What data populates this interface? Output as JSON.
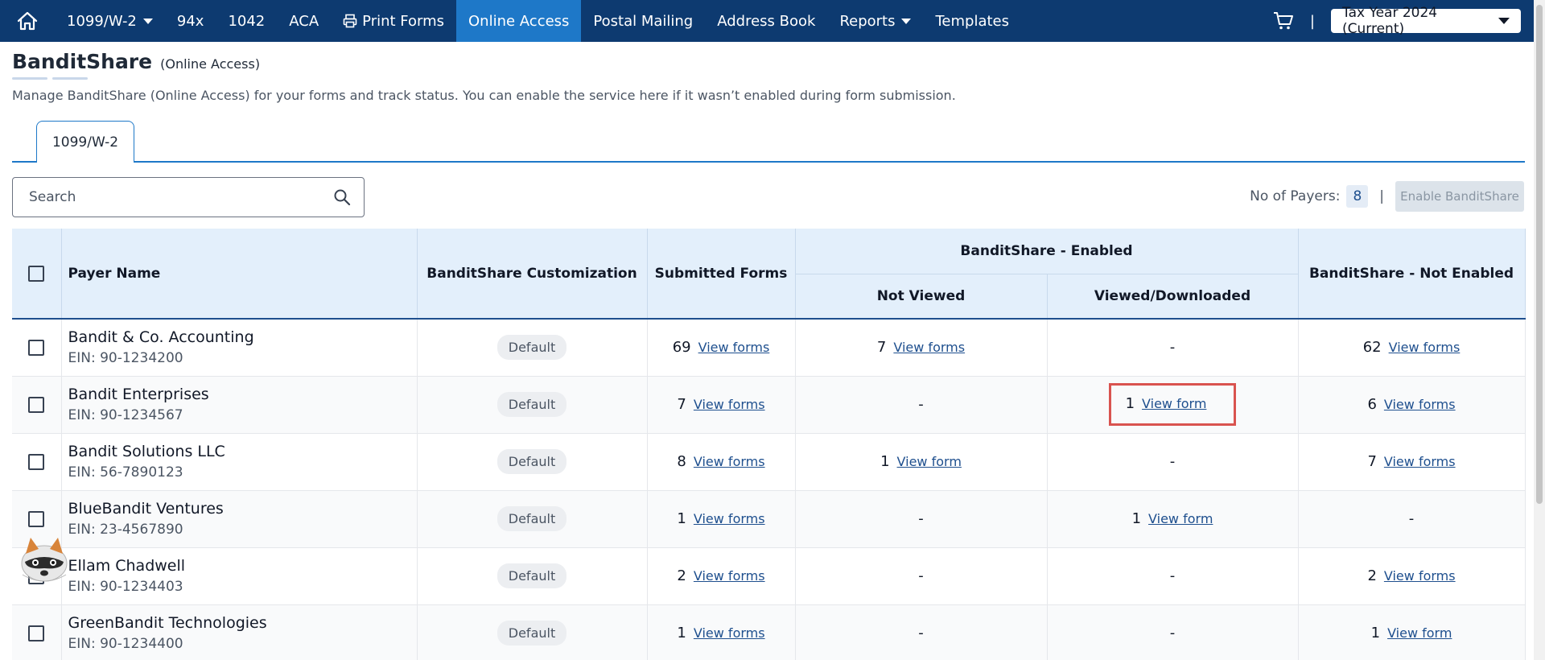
{
  "nav": {
    "items": [
      {
        "label": "1099/W-2",
        "dropdown": true
      },
      {
        "label": "94x"
      },
      {
        "label": "1042"
      },
      {
        "label": "ACA"
      },
      {
        "label": "Print Forms",
        "icon": "printer-icon"
      },
      {
        "label": "Online Access",
        "active": true
      },
      {
        "label": "Postal Mailing"
      },
      {
        "label": "Address Book"
      },
      {
        "label": "Reports",
        "dropdown": true
      },
      {
        "label": "Templates"
      }
    ],
    "separator": "|",
    "tax_year": "Tax Year 2024 (Current)",
    "colors": {
      "bar": "#0d3a70",
      "active": "#1e78c8"
    }
  },
  "header": {
    "title": "BanditShare",
    "subtitle": "(Online Access)",
    "description": "Manage BanditShare (Online Access) for your forms and track status. You can enable the service here if it wasn’t enabled during form submission."
  },
  "tabs": [
    {
      "label": "1099/W-2",
      "active": true
    }
  ],
  "search": {
    "placeholder": "Search"
  },
  "payers": {
    "label": "No of Payers:",
    "count": "8",
    "separator": "|"
  },
  "enable_button": "Enable BanditShare",
  "table": {
    "headers": {
      "payer_name": "Payer Name",
      "customization": "BanditShare Customization",
      "submitted": "Submitted Forms",
      "enabled_group": "BanditShare - Enabled",
      "not_viewed": "Not Viewed",
      "viewed": "Viewed/Downloaded",
      "not_enabled": "BanditShare - Not Enabled"
    },
    "rows": [
      {
        "name": "Bandit & Co. Accounting",
        "ein": "EIN: 90-1234200",
        "customization": "Default",
        "submitted": {
          "count": "69",
          "link": "View forms"
        },
        "not_viewed": {
          "count": "7",
          "link": "View forms"
        },
        "viewed": {
          "count": "",
          "link": "",
          "dash": "-"
        },
        "not_enabled": {
          "count": "62",
          "link": "View forms"
        }
      },
      {
        "name": "Bandit Enterprises",
        "ein": "EIN: 90-1234567",
        "customization": "Default",
        "submitted": {
          "count": "7",
          "link": "View forms"
        },
        "not_viewed": {
          "count": "",
          "link": "",
          "dash": "-"
        },
        "viewed": {
          "count": "1",
          "link": "View form",
          "highlighted": true
        },
        "not_enabled": {
          "count": "6",
          "link": "View forms"
        }
      },
      {
        "name": "Bandit Solutions LLC",
        "ein": "EIN: 56-7890123",
        "customization": "Default",
        "submitted": {
          "count": "8",
          "link": "View forms"
        },
        "not_viewed": {
          "count": "1",
          "link": "View form"
        },
        "viewed": {
          "count": "",
          "link": "",
          "dash": "-"
        },
        "not_enabled": {
          "count": "7",
          "link": "View forms"
        }
      },
      {
        "name": "BlueBandit Ventures",
        "ein": "EIN: 23-4567890",
        "customization": "Default",
        "submitted": {
          "count": "1",
          "link": "View forms"
        },
        "not_viewed": {
          "count": "",
          "link": "",
          "dash": "-"
        },
        "viewed": {
          "count": "1",
          "link": "View form"
        },
        "not_enabled": {
          "count": "",
          "link": "",
          "dash": "-"
        }
      },
      {
        "name": "Ellam Chadwell",
        "ein": "EIN: 90-1234403",
        "customization": "Default",
        "submitted": {
          "count": "2",
          "link": "View forms"
        },
        "not_viewed": {
          "count": "",
          "link": "",
          "dash": "-"
        },
        "viewed": {
          "count": "",
          "link": "",
          "dash": "-"
        },
        "not_enabled": {
          "count": "2",
          "link": "View forms"
        }
      },
      {
        "name": "GreenBandit Technologies",
        "ein": "EIN: 90-1234400",
        "customization": "Default",
        "submitted": {
          "count": "1",
          "link": "View forms"
        },
        "not_viewed": {
          "count": "",
          "link": "",
          "dash": "-"
        },
        "viewed": {
          "count": "",
          "link": "",
          "dash": "-"
        },
        "not_enabled": {
          "count": "1",
          "link": "View form"
        }
      }
    ]
  }
}
